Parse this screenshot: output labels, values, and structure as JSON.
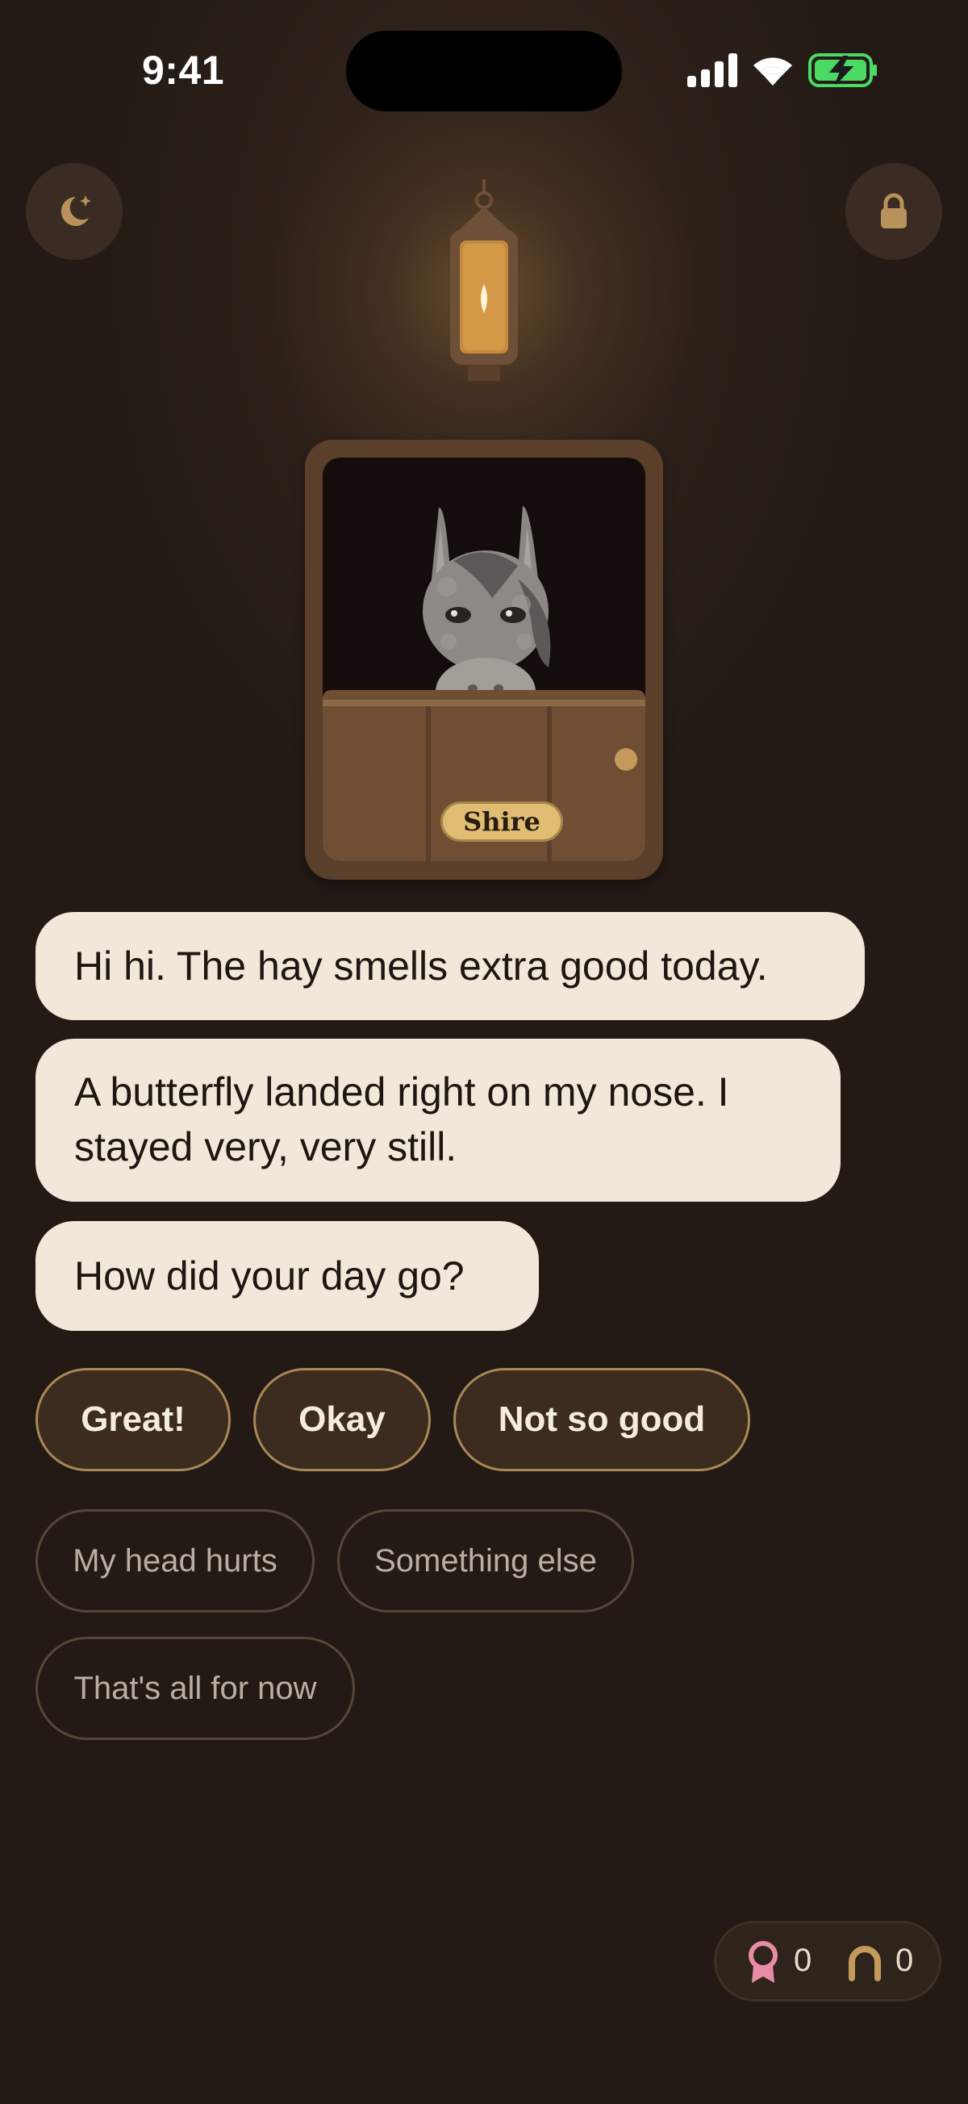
{
  "status_bar": {
    "time": "9:41",
    "icons": [
      "cellular-signal-icon",
      "wifi-icon",
      "battery-charging-icon"
    ]
  },
  "top_controls": {
    "night_mode_icon": "moon-stars-icon",
    "lock_icon": "lock-icon"
  },
  "scene": {
    "lantern_icon": "lantern-icon",
    "horse_name": "Shire"
  },
  "messages": [
    "Hi hi. The hay smells extra good today.",
    "A butterfly landed right on my nose. I stayed very, very still.",
    "How did your day go?"
  ],
  "replies": {
    "primary": [
      "Great!",
      "Okay",
      "Not so good"
    ],
    "secondary": [
      "My head hurts",
      "Something else",
      "That's all for now"
    ]
  },
  "counters": {
    "ribbons": {
      "icon": "ribbon-icon",
      "value": "0"
    },
    "horseshoes": {
      "icon": "horseshoe-icon",
      "value": "0"
    }
  },
  "colors": {
    "background": "#231a15",
    "bubble": "#f1e8da",
    "accent_gold": "#c4995a",
    "ribbon_pink": "#e88ca6",
    "battery_green": "#4cd964"
  }
}
